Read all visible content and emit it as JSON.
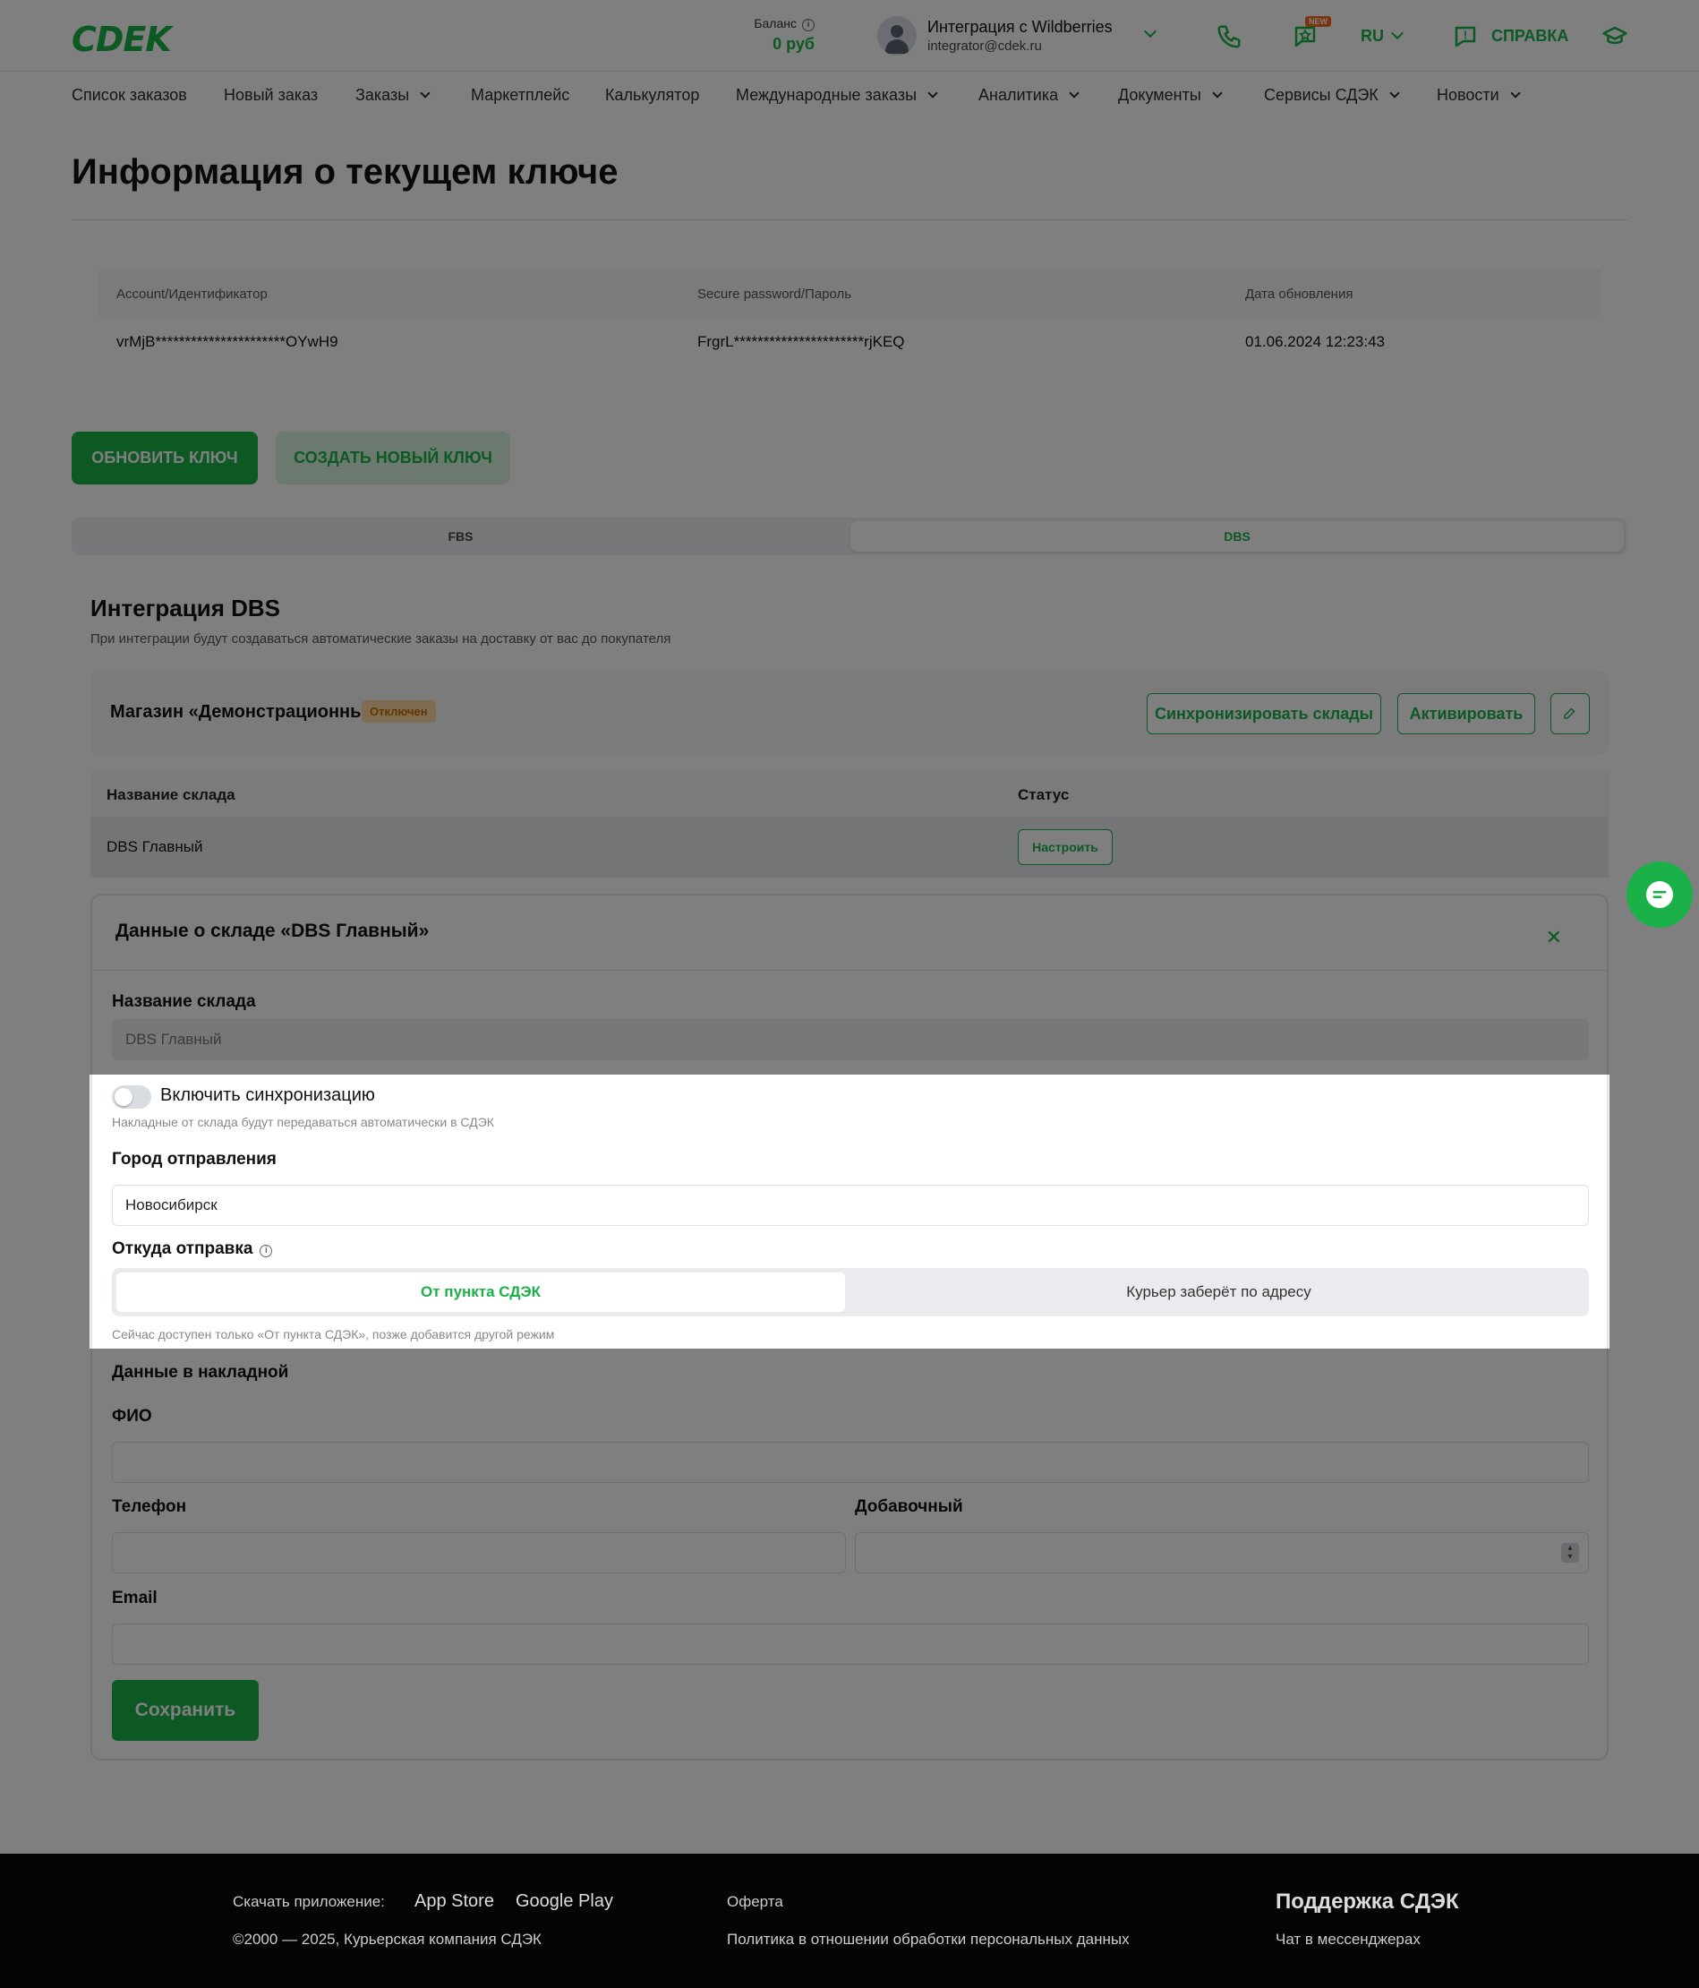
{
  "header": {
    "logo": "CDEK",
    "balance_label": "Баланс",
    "balance_value": "0 руб",
    "account_name": "Интеграция с Wildberries",
    "account_email": "integrator@cdek.ru",
    "new_badge": "NEW",
    "lang": "RU",
    "help": "СПРАВКА"
  },
  "nav": [
    "Список заказов",
    "Новый заказ",
    "Заказы",
    "Маркетплейс",
    "Калькулятор",
    "Международные заказы",
    "Аналитика",
    "Документы",
    "Сервисы СДЭК",
    "Новости"
  ],
  "page": {
    "title": "Информация о текущем ключе"
  },
  "key": {
    "headers": [
      "Account/Идентификатор",
      "Secure password/Пароль",
      "Дата обновления"
    ],
    "values": [
      "vrMjB**********************OYwH9",
      "FrgrL**********************rjKEQ",
      "01.06.2024 12:23:43"
    ]
  },
  "buttons": {
    "update_key": "ОБНОВИТЬ КЛЮЧ",
    "create_key": "СОЗДАТЬ НОВЫЙ КЛЮЧ"
  },
  "tabs": [
    "FBS",
    "DBS"
  ],
  "dbs": {
    "title": "Интеграция DBS",
    "subtitle": "При интеграции будут создаваться автоматические заказы на доставку от вас до покупателя",
    "store_name": "Магазин «Демонстрационный»",
    "store_status": "Отключен",
    "sync_button": "Синхронизировать склады",
    "activate_button": "Активировать",
    "table_headers": [
      "Название склада",
      "Статус"
    ],
    "rows": [
      {
        "name": "DBS Главный",
        "action": "Настроить"
      }
    ]
  },
  "detail": {
    "title": "Данные о складе «DBS Главный»",
    "warehouse_label": "Название склада",
    "warehouse_value": "DBS Главный",
    "sync_label": "Включить синхронизацию",
    "sync_hint": "Накладные от склада будут передаваться автоматически в СДЭК",
    "city_label": "Город отправления",
    "city_value": "Новосибирск",
    "from_label": "Откуда отправка",
    "from_options": [
      "От пункта СДЭК",
      "Курьер заберёт по адресу"
    ],
    "from_hint": "Сейчас доступен только «От пункта СДЭК», позже добавится другой режим",
    "invoice_title": "Данные в накладной",
    "fio_label": "ФИО",
    "phone_label": "Телефон",
    "ext_label": "Добавочный",
    "email_label": "Email",
    "save_button": "Сохранить"
  },
  "footer": {
    "download_label": "Скачать приложение:",
    "app_store": "App Store",
    "google_play": "Google Play",
    "copyright": "©2000 — 2025, Курьерская компания СДЭК",
    "offer": "Оферта",
    "privacy": "Политика в отношении обработки персональных данных",
    "support_title": "Поддержка СДЭК",
    "support_chat": "Чат в мессенджерах"
  },
  "colors": {
    "brand": "#1ab248",
    "warning_bg": "#ffd9a3",
    "footer_bg": "#050505"
  }
}
